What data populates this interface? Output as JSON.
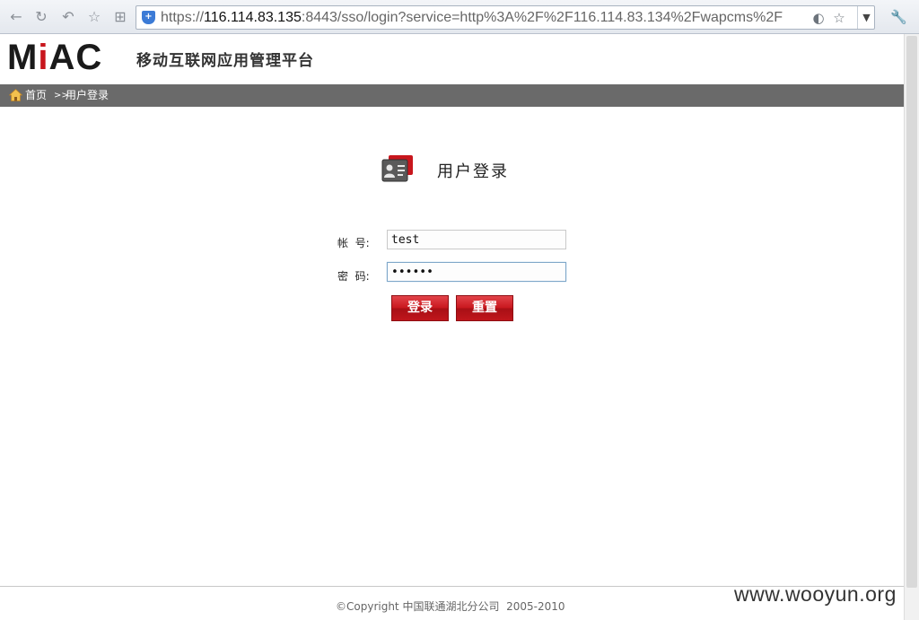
{
  "browser": {
    "url_prefix": "https://",
    "url_host": "116.114.83.135",
    "url_rest": ":8443/sso/login?service=http%3A%2F%2F116.114.83.134%2Fwapcms%2F",
    "icons": [
      "back-icon",
      "forward-icon",
      "reload-icon",
      "home-icon",
      "star-icon",
      "tab-grid-icon",
      "shield-icon",
      "compat-icon",
      "bookmark-star-icon",
      "dropdown-arrow-icon",
      "wrench-icon"
    ]
  },
  "header": {
    "logo_prefix": "M",
    "logo_i": "i",
    "logo_suffix": "AC",
    "platform_title": "移动互联网应用管理平台"
  },
  "breadcrumb": {
    "home": "首页",
    "separator": ">>",
    "current": "用户登录"
  },
  "login": {
    "title": "用户登录",
    "account_label": "帐  号:",
    "account_value": "test",
    "password_label": "密  码:",
    "password_value": "••••••",
    "login_button": "登录",
    "reset_button": "重置"
  },
  "footer": {
    "copyright": "©Copyright 中国联通湖北分公司  2005-2010"
  },
  "watermark": "www.wooyun.org",
  "colors": {
    "brand_red": "#c8161d",
    "breadcrumb_bg": "#6a6a6a"
  }
}
